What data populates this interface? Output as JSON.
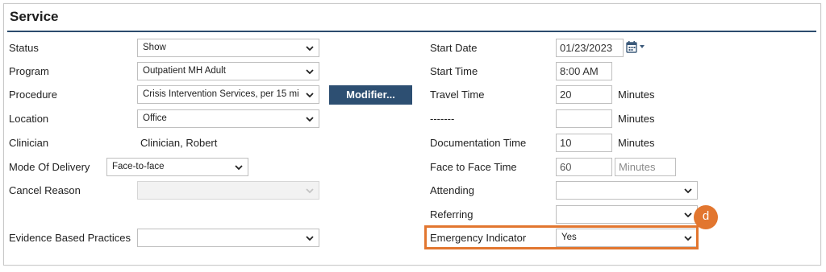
{
  "section": {
    "title": "Service"
  },
  "left": {
    "status": {
      "label": "Status",
      "value": "Show"
    },
    "program": {
      "label": "Program",
      "value": "Outpatient MH Adult"
    },
    "procedure": {
      "label": "Procedure",
      "value": "Crisis Intervention Services, per 15 mi",
      "modifier_button": "Modifier..."
    },
    "location": {
      "label": "Location",
      "value": "Office"
    },
    "clinician": {
      "label": "Clinician",
      "value": "Clinician, Robert"
    },
    "mode_of_delivery": {
      "label": "Mode Of Delivery",
      "value": "Face-to-face"
    },
    "cancel_reason": {
      "label": "Cancel Reason",
      "value": ""
    },
    "evidence_based_practices": {
      "label": "Evidence Based Practices",
      "value": ""
    }
  },
  "right": {
    "start_date": {
      "label": "Start Date",
      "value": "01/23/2023"
    },
    "start_time": {
      "label": "Start Time",
      "value": "8:00 AM"
    },
    "travel_time": {
      "label": "Travel Time",
      "value": "20",
      "unit": "Minutes"
    },
    "dashes": {
      "label": "-------",
      "value": "",
      "unit": "Minutes"
    },
    "documentation_time": {
      "label": "Documentation Time",
      "value": "10",
      "unit": "Minutes"
    },
    "face_to_face_time": {
      "label": "Face to Face Time",
      "value": "60",
      "unit_placeholder": "Minutes"
    },
    "attending": {
      "label": "Attending",
      "value": ""
    },
    "referring": {
      "label": "Referring",
      "value": ""
    },
    "emergency_indicator": {
      "label": "Emergency Indicator",
      "value": "Yes"
    }
  },
  "annotation": {
    "callout_letter": "d",
    "color": "#e2762f"
  },
  "colors": {
    "accent": "#2d4f72",
    "title_rule": "#2c4c6e"
  },
  "icons": {
    "dropdown": "chevron-down-icon",
    "calendar": "calendar-icon"
  }
}
